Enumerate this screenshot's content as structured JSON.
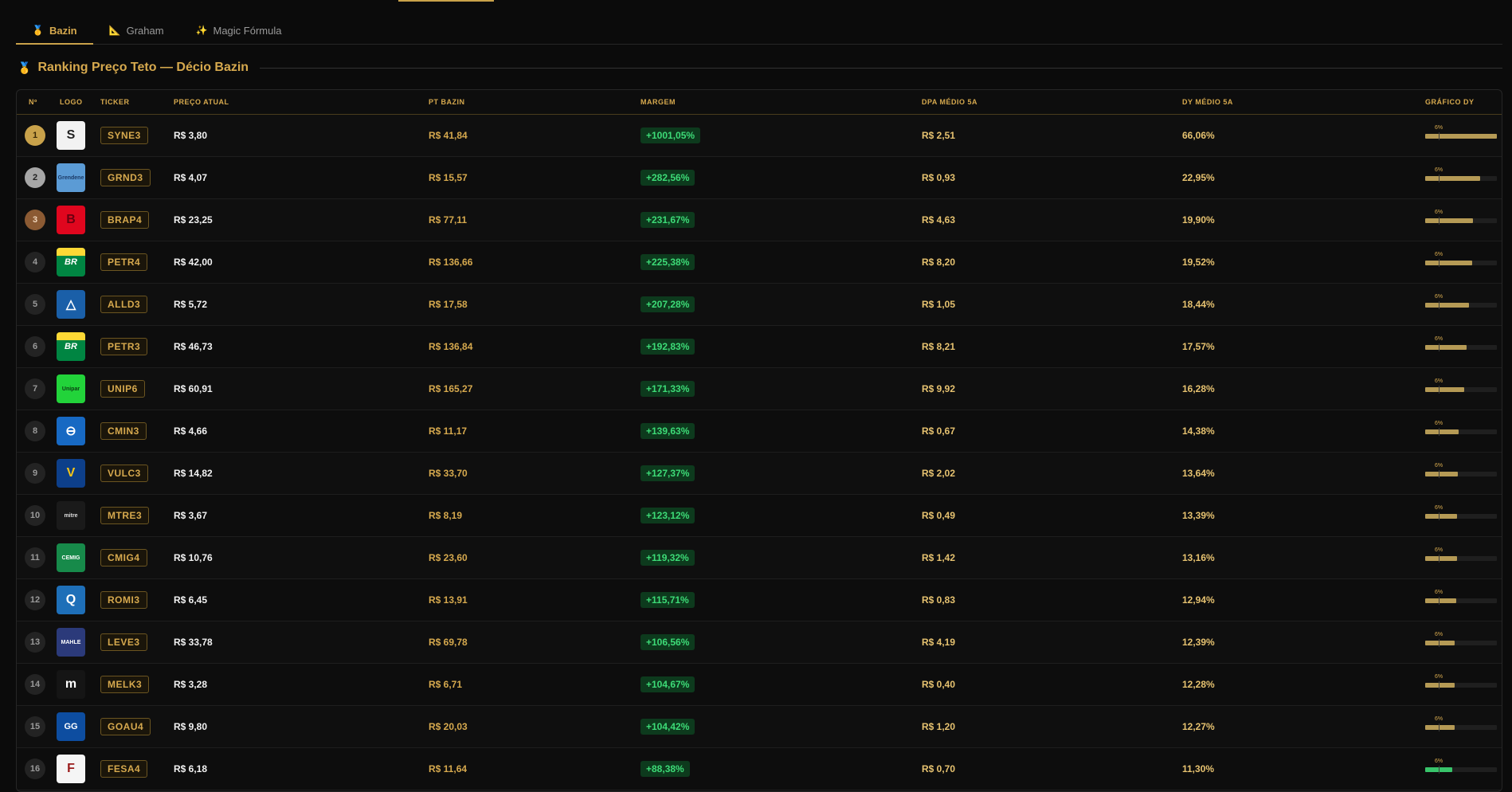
{
  "tabs": [
    {
      "icon": "🥇",
      "label": "Bazin",
      "active": true
    },
    {
      "icon": "📐",
      "label": "Graham",
      "active": false
    },
    {
      "icon": "✨",
      "label": "Magic Fórmula",
      "active": false
    }
  ],
  "section": {
    "icon": "🥇",
    "title": "Ranking Preço Teto — Décio Bazin"
  },
  "columns": [
    "Nº",
    "LOGO",
    "TICKER",
    "PREÇO ATUAL",
    "PT BAZIN",
    "MARGEM",
    "DPA MÉDIO 5A",
    "DY MÉDIO 5A",
    "GRÁFICO DY"
  ],
  "rows": [
    {
      "n": "1",
      "ticker": "SYNE3",
      "price": "R$ 3,80",
      "pt": "R$ 41,84",
      "margin": "+1001,05%",
      "dpa": "R$ 2,51",
      "dy": "66,06%",
      "dy_bar": 1.0,
      "bar_label": "6%",
      "logo": {
        "text": "S",
        "bg": "#f2f2f2",
        "fg": "#222222"
      }
    },
    {
      "n": "2",
      "ticker": "GRND3",
      "price": "R$ 4,07",
      "pt": "R$ 15,57",
      "margin": "+282,56%",
      "dpa": "R$ 0,93",
      "dy": "22,95%",
      "dy_bar": 0.77,
      "bar_label": "6%",
      "logo": {
        "text": "Grendene",
        "bg": "#5b9bd5",
        "fg": "#1b3a66"
      }
    },
    {
      "n": "3",
      "ticker": "BRAP4",
      "price": "R$ 23,25",
      "pt": "R$ 77,11",
      "margin": "+231,67%",
      "dpa": "R$ 4,63",
      "dy": "19,90%",
      "dy_bar": 0.67,
      "bar_label": "6%",
      "logo": {
        "text": "B",
        "bg": "#e0061e",
        "fg": "#6a0010"
      }
    },
    {
      "n": "4",
      "ticker": "PETR4",
      "price": "R$ 42,00",
      "pt": "R$ 136,66",
      "margin": "+225,38%",
      "dpa": "R$ 8,20",
      "dy": "19,52%",
      "dy_bar": 0.65,
      "bar_label": "6%",
      "logo": {
        "text": "BR",
        "bg": "#008542",
        "fg": "#ffffff",
        "top": "#fdd835"
      }
    },
    {
      "n": "5",
      "ticker": "ALLD3",
      "price": "R$ 5,72",
      "pt": "R$ 17,58",
      "margin": "+207,28%",
      "dpa": "R$ 1,05",
      "dy": "18,44%",
      "dy_bar": 0.61,
      "bar_label": "6%",
      "logo": {
        "text": "△",
        "bg": "#1a5fa8",
        "fg": "#ffffff"
      }
    },
    {
      "n": "6",
      "ticker": "PETR3",
      "price": "R$ 46,73",
      "pt": "R$ 136,84",
      "margin": "+192,83%",
      "dpa": "R$ 8,21",
      "dy": "17,57%",
      "dy_bar": 0.58,
      "bar_label": "6%",
      "logo": {
        "text": "BR",
        "bg": "#008542",
        "fg": "#ffffff",
        "top": "#fdd835"
      }
    },
    {
      "n": "7",
      "ticker": "UNIP6",
      "price": "R$ 60,91",
      "pt": "R$ 165,27",
      "margin": "+171,33%",
      "dpa": "R$ 9,92",
      "dy": "16,28%",
      "dy_bar": 0.54,
      "bar_label": "6%",
      "logo": {
        "text": "Unipar",
        "bg": "#22d33a",
        "fg": "#0b3d12"
      }
    },
    {
      "n": "8",
      "ticker": "CMIN3",
      "price": "R$ 4,66",
      "pt": "R$ 11,17",
      "margin": "+139,63%",
      "dpa": "R$ 0,67",
      "dy": "14,38%",
      "dy_bar": 0.47,
      "bar_label": "6%",
      "logo": {
        "text": "⊖",
        "bg": "#1769c3",
        "fg": "#ffffff"
      }
    },
    {
      "n": "9",
      "ticker": "VULC3",
      "price": "R$ 14,82",
      "pt": "R$ 33,70",
      "margin": "+127,37%",
      "dpa": "R$ 2,02",
      "dy": "13,64%",
      "dy_bar": 0.45,
      "bar_label": "6%",
      "logo": {
        "text": "V",
        "bg": "#0d3f8a",
        "fg": "#f5c518"
      }
    },
    {
      "n": "10",
      "ticker": "MTRE3",
      "price": "R$ 3,67",
      "pt": "R$ 8,19",
      "margin": "+123,12%",
      "dpa": "R$ 0,49",
      "dy": "13,39%",
      "dy_bar": 0.44,
      "bar_label": "6%",
      "logo": {
        "text": "mitre",
        "bg": "#1a1a1a",
        "fg": "#dddddd"
      }
    },
    {
      "n": "11",
      "ticker": "CMIG4",
      "price": "R$ 10,76",
      "pt": "R$ 23,60",
      "margin": "+119,32%",
      "dpa": "R$ 1,42",
      "dy": "13,16%",
      "dy_bar": 0.44,
      "bar_label": "6%",
      "logo": {
        "text": "CEMIG",
        "bg": "#178a4a",
        "fg": "#ffffff"
      }
    },
    {
      "n": "12",
      "ticker": "ROMI3",
      "price": "R$ 6,45",
      "pt": "R$ 13,91",
      "margin": "+115,71%",
      "dpa": "R$ 0,83",
      "dy": "12,94%",
      "dy_bar": 0.43,
      "bar_label": "6%",
      "logo": {
        "text": "Q",
        "bg": "#1e6fb8",
        "fg": "#ffffff"
      }
    },
    {
      "n": "13",
      "ticker": "LEVE3",
      "price": "R$ 33,78",
      "pt": "R$ 69,78",
      "margin": "+106,56%",
      "dpa": "R$ 4,19",
      "dy": "12,39%",
      "dy_bar": 0.41,
      "bar_label": "6%",
      "logo": {
        "text": "MAHLE",
        "bg": "#2b3a7a",
        "fg": "#ffffff"
      }
    },
    {
      "n": "14",
      "ticker": "MELK3",
      "price": "R$ 3,28",
      "pt": "R$ 6,71",
      "margin": "+104,67%",
      "dpa": "R$ 0,40",
      "dy": "12,28%",
      "dy_bar": 0.41,
      "bar_label": "6%",
      "logo": {
        "text": "m",
        "bg": "#151515",
        "fg": "#ffffff"
      }
    },
    {
      "n": "15",
      "ticker": "GOAU4",
      "price": "R$ 9,80",
      "pt": "R$ 20,03",
      "margin": "+104,42%",
      "dpa": "R$ 1,20",
      "dy": "12,27%",
      "dy_bar": 0.41,
      "bar_label": "6%",
      "logo": {
        "text": "GG",
        "bg": "#0d4da0",
        "fg": "#ffffff"
      }
    },
    {
      "n": "16",
      "ticker": "FESA4",
      "price": "R$ 6,18",
      "pt": "R$ 11,64",
      "margin": "+88,38%",
      "dpa": "R$ 0,70",
      "dy": "11,30%",
      "dy_bar": 0.38,
      "bar_label": "6%",
      "bar_color": "green",
      "logo": {
        "text": "F",
        "bg": "#f5f5f5",
        "fg": "#9a1b1b"
      }
    }
  ]
}
